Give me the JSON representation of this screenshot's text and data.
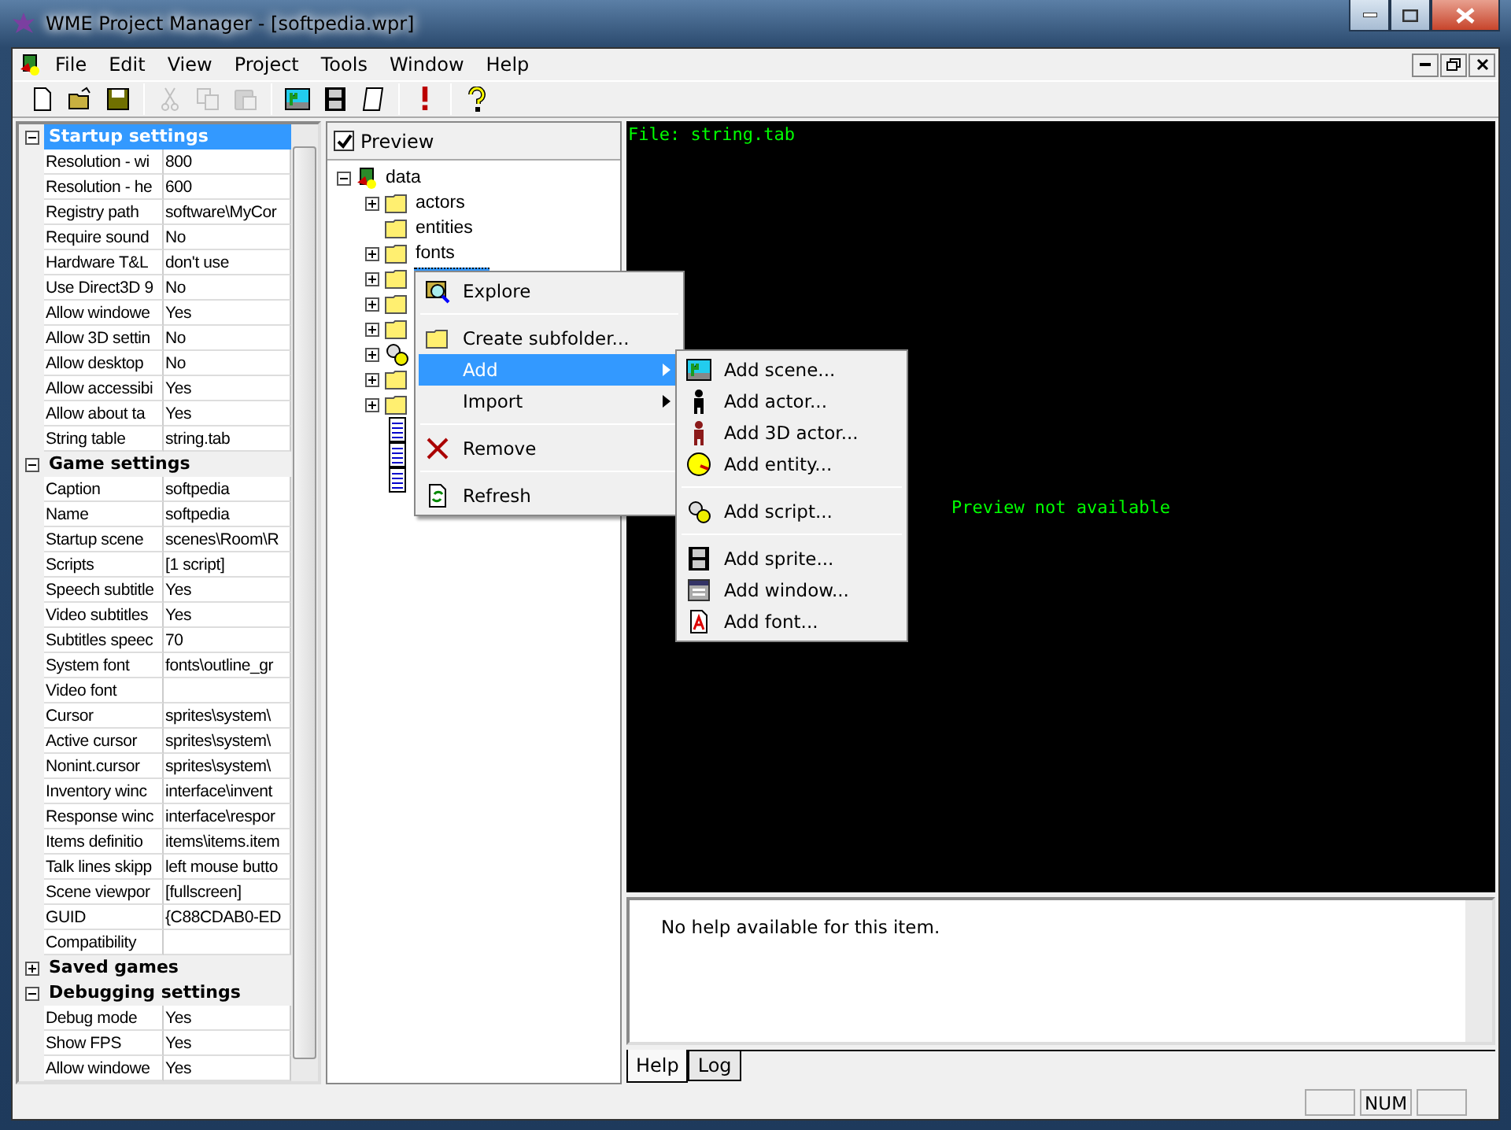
{
  "window": {
    "title": "WME Project Manager - [softpedia.wpr]"
  },
  "menu_bar": [
    "File",
    "Edit",
    "View",
    "Project",
    "Tools",
    "Window",
    "Help"
  ],
  "toolbar": [
    {
      "kind": "new",
      "disabled": false
    },
    {
      "kind": "open",
      "disabled": false
    },
    {
      "kind": "save",
      "disabled": false
    },
    {
      "kind": "sep"
    },
    {
      "kind": "cut",
      "disabled": true
    },
    {
      "kind": "copy",
      "disabled": true
    },
    {
      "kind": "paste",
      "disabled": true
    },
    {
      "kind": "sep"
    },
    {
      "kind": "scene",
      "disabled": false
    },
    {
      "kind": "film",
      "disabled": false
    },
    {
      "kind": "script",
      "disabled": false
    },
    {
      "kind": "sep"
    },
    {
      "kind": "run",
      "disabled": false
    },
    {
      "kind": "sep"
    },
    {
      "kind": "help",
      "disabled": false
    }
  ],
  "properties": [
    {
      "title": "Startup settings",
      "expanded": true,
      "selected": true,
      "rows": [
        {
          "name": "Resolution - wi",
          "value": "800"
        },
        {
          "name": "Resolution - he",
          "value": "600"
        },
        {
          "name": "Registry path",
          "value": "software\\MyCor"
        },
        {
          "name": "Require sound",
          "value": "No"
        },
        {
          "name": "Hardware T&L",
          "value": "don't use"
        },
        {
          "name": "Use Direct3D 9",
          "value": "No"
        },
        {
          "name": "Allow windowe",
          "value": "Yes"
        },
        {
          "name": "Allow 3D settin",
          "value": "No"
        },
        {
          "name": "Allow desktop",
          "value": "No"
        },
        {
          "name": "Allow accessibi",
          "value": "Yes"
        },
        {
          "name": "Allow about ta",
          "value": "Yes"
        },
        {
          "name": "String table",
          "value": "string.tab"
        }
      ]
    },
    {
      "title": "Game settings",
      "expanded": true,
      "selected": false,
      "rows": [
        {
          "name": "Caption",
          "value": "softpedia"
        },
        {
          "name": "Name",
          "value": "softpedia"
        },
        {
          "name": "Startup scene",
          "value": "scenes\\Room\\R"
        },
        {
          "name": "Scripts",
          "value": "[1 script]"
        },
        {
          "name": "Speech subtitle",
          "value": "Yes"
        },
        {
          "name": "Video subtitles",
          "value": "Yes"
        },
        {
          "name": "Subtitles speec",
          "value": "70"
        },
        {
          "name": "System font",
          "value": "fonts\\outline_gr"
        },
        {
          "name": "Video font"
        },
        {
          "name": "Cursor",
          "value": "sprites\\system\\"
        },
        {
          "name": "Active cursor",
          "value": "sprites\\system\\"
        },
        {
          "name": "Nonint.cursor",
          "value": "sprites\\system\\"
        },
        {
          "name": "Inventory winc",
          "value": "interface\\invent"
        },
        {
          "name": "Response winc",
          "value": "interface\\respor"
        },
        {
          "name": "Items definitio",
          "value": "items\\items.item"
        },
        {
          "name": "Talk lines skipp",
          "value": "left mouse butto"
        },
        {
          "name": "Scene viewpor",
          "value": "[fullscreen]"
        },
        {
          "name": "GUID",
          "value": "{C88CDAB0-ED"
        },
        {
          "name": "Compatibility"
        }
      ]
    },
    {
      "title": "Saved games",
      "expanded": false,
      "selected": false
    },
    {
      "title": "Debugging settings",
      "expanded": true,
      "selected": false,
      "rows": [
        {
          "name": "Debug mode",
          "value": "Yes"
        },
        {
          "name": "Show FPS",
          "value": "Yes"
        },
        {
          "name": "Allow windowe",
          "value": "Yes"
        }
      ]
    }
  ],
  "preview": {
    "label": "Preview",
    "checked": true
  },
  "tree": {
    "root": "data",
    "expanded": true,
    "children": [
      {
        "kind": "folder",
        "label": "actors",
        "expandable": true,
        "selected": false
      },
      {
        "kind": "folder",
        "label": "entities",
        "expandable": false,
        "selected": false
      },
      {
        "kind": "folder",
        "label": "fonts",
        "expandable": true,
        "selected": false
      },
      {
        "kind": "folder",
        "expandable": true,
        "selected": true
      },
      {
        "kind": "folder",
        "expandable": true,
        "selected": false
      },
      {
        "kind": "folder",
        "expandable": true,
        "selected": false
      },
      {
        "kind": "scripts",
        "expandable": true,
        "selected": false
      },
      {
        "kind": "folder",
        "expandable": true,
        "selected": false
      },
      {
        "kind": "folder",
        "expandable": true,
        "selected": false
      },
      {
        "kind": "file",
        "expandable": false,
        "selected": false
      },
      {
        "kind": "file",
        "expandable": false,
        "selected": false
      },
      {
        "kind": "file",
        "expandable": false,
        "selected": false
      }
    ]
  },
  "context_menu": [
    {
      "kind": "explore",
      "label": "Explore",
      "highlighted": false,
      "submenu": false
    },
    {
      "kind": "sep"
    },
    {
      "kind": "folder",
      "label": "Create subfolder...",
      "highlighted": false,
      "submenu": false
    },
    {
      "kind": "plain",
      "label": "Add",
      "highlighted": true,
      "submenu": true
    },
    {
      "kind": "plain",
      "label": "Import",
      "highlighted": false,
      "submenu": true
    },
    {
      "kind": "sep"
    },
    {
      "kind": "remove",
      "label": "Remove",
      "highlighted": false,
      "submenu": false
    },
    {
      "kind": "sep"
    },
    {
      "kind": "refresh",
      "label": "Refresh",
      "highlighted": false,
      "submenu": false
    }
  ],
  "submenu": [
    {
      "kind": "scene",
      "label": "Add scene..."
    },
    {
      "kind": "actor",
      "label": "Add actor..."
    },
    {
      "kind": "actor3d",
      "label": "Add 3D actor..."
    },
    {
      "kind": "entity",
      "label": "Add entity..."
    },
    {
      "kind": "sep"
    },
    {
      "kind": "script",
      "label": "Add script..."
    },
    {
      "kind": "sep"
    },
    {
      "kind": "sprite",
      "label": "Add sprite..."
    },
    {
      "kind": "window",
      "label": "Add window..."
    },
    {
      "kind": "font",
      "label": "Add font..."
    }
  ],
  "preview_pane": {
    "file": "File: string.tab",
    "message": "Preview not available"
  },
  "help_pane": {
    "text": "No help available for this item."
  },
  "bottom_tabs": [
    {
      "label": "Help",
      "selected": true
    },
    {
      "label": "Log",
      "selected": false
    }
  ],
  "status_bar": {
    "num": "NUM"
  }
}
